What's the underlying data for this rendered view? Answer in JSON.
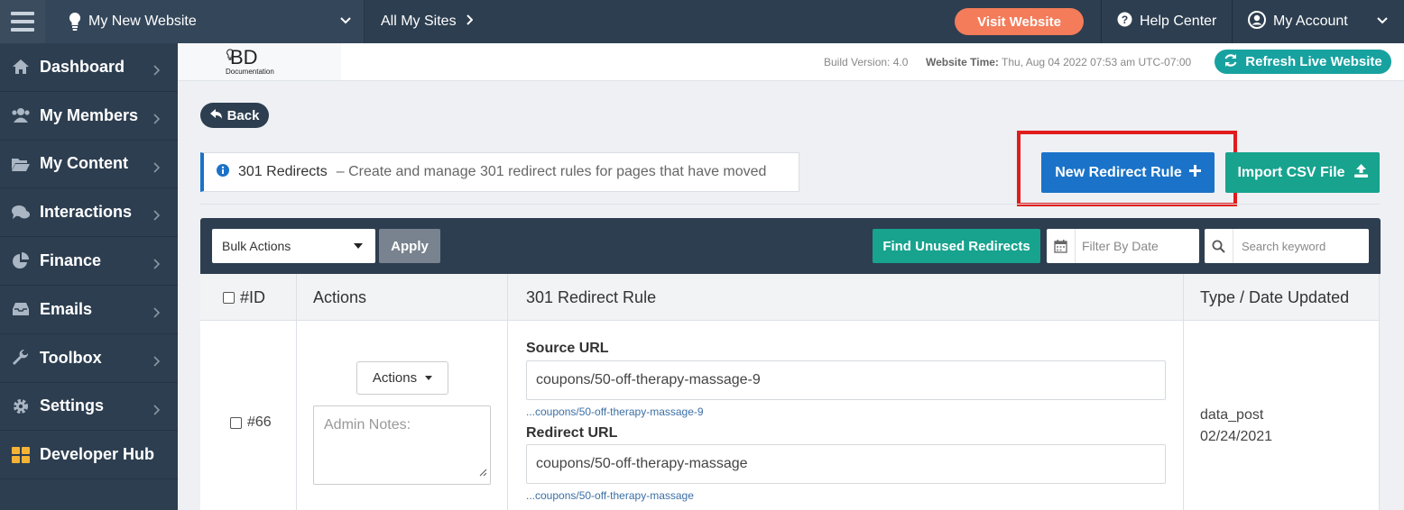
{
  "topbar": {
    "site_name": "My New Website",
    "all_sites": "All My Sites",
    "visit_button": "Visit Website",
    "help_center": "Help Center",
    "my_account": "My Account"
  },
  "sidebar": {
    "items": [
      {
        "label": "Dashboard",
        "icon": "home-icon"
      },
      {
        "label": "My Members",
        "icon": "users-icon"
      },
      {
        "label": "My Content",
        "icon": "folder-open-icon"
      },
      {
        "label": "Interactions",
        "icon": "comments-icon"
      },
      {
        "label": "Finance",
        "icon": "pie-chart-icon"
      },
      {
        "label": "Emails",
        "icon": "inbox-icon"
      },
      {
        "label": "Toolbox",
        "icon": "wrench-icon"
      },
      {
        "label": "Settings",
        "icon": "gear-icon"
      },
      {
        "label": "Developer Hub",
        "icon": "grid-icon"
      }
    ]
  },
  "subheader": {
    "logo_text": "BD",
    "logo_sub": "Documentation",
    "build_version": "Build Version: 4.0",
    "website_time_label": "Website Time:",
    "website_time_value": "Thu, Aug 04 2022 07:53 am UTC-07:00",
    "refresh_button": "Refresh Live Website"
  },
  "main": {
    "back_button": "Back",
    "info_title": "301 Redirects",
    "info_desc": "– Create and manage 301 redirect rules for pages that have moved",
    "new_rule_button": "New Redirect Rule",
    "import_button": "Import CSV File",
    "highlight_color": "#e11c1c"
  },
  "toolbar": {
    "bulk_actions": "Bulk Actions",
    "apply": "Apply",
    "find_unused": "Find Unused Redirects",
    "date_placeholder": "Filter By Date",
    "keyword_placeholder": "Search keyword"
  },
  "table": {
    "headers": [
      "#ID",
      "Actions",
      "301 Redirect Rule",
      "Type / Date Updated"
    ],
    "rows": [
      {
        "id": "#66",
        "actions_button": "Actions",
        "notes_placeholder": "Admin Notes:",
        "source_label": "Source URL",
        "source_value": "coupons/50-off-therapy-massage-9",
        "source_link": "...coupons/50-off-therapy-massage-9",
        "redirect_label": "Redirect URL",
        "redirect_value": "coupons/50-off-therapy-massage",
        "redirect_link": "...coupons/50-off-therapy-massage",
        "type": "data_post",
        "date": "02/24/2021"
      }
    ]
  }
}
